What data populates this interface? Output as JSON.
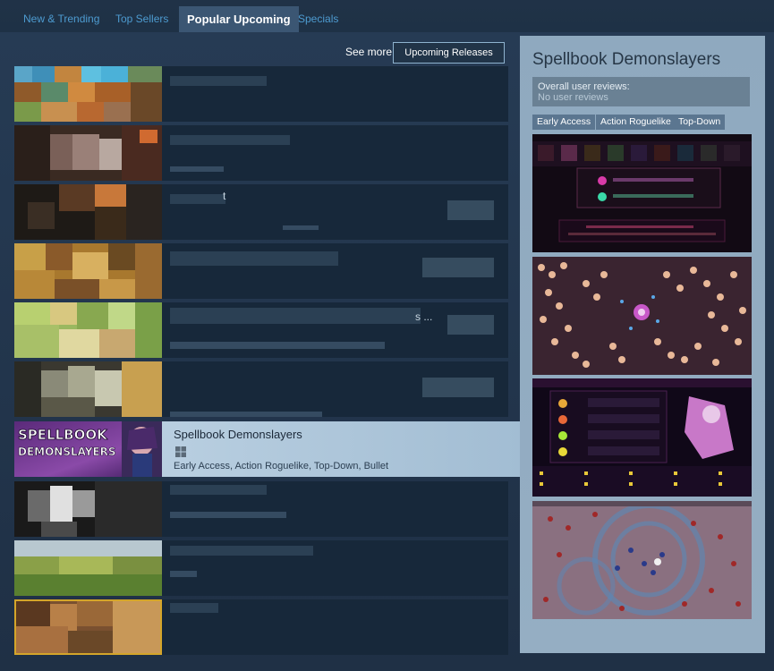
{
  "tabs": [
    {
      "label": "New & Trending"
    },
    {
      "label": "Top Sellers"
    },
    {
      "label": "Popular Upcoming"
    },
    {
      "label": "Specials"
    }
  ],
  "see_more": {
    "label": "See more:",
    "button": "Upcoming Releases"
  },
  "rows": {
    "row3_fragment": "t",
    "row5_fragment": "s ...",
    "highlighted": {
      "name": "Spellbook Demonslayers",
      "tags": "Early Access, Action Roguelike, Top-Down, Bullet H",
      "capsule_text_1": "SPELLBOOK",
      "capsule_text_2": "DEMONSLAYERS"
    }
  },
  "preview": {
    "title": "Spellbook Demonslayers",
    "reviews_label": "Overall user reviews:",
    "reviews_value": "No user reviews",
    "tags": [
      "Early Access",
      "Action Roguelike",
      "Top-Down"
    ]
  },
  "colors": {
    "accent": "#4d9bd0",
    "highlight_row": "#c2d6e6",
    "gold_border": "#d4a52a"
  }
}
